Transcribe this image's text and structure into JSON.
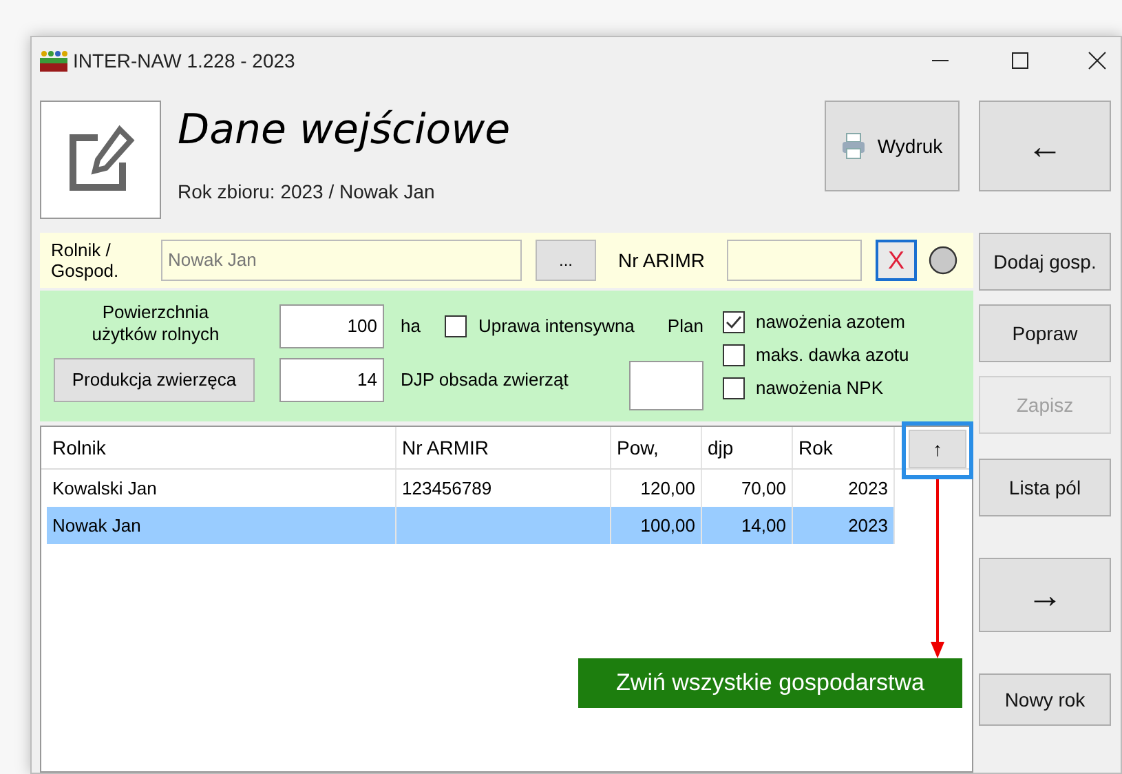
{
  "window": {
    "title": "INTER-NAW 1.228 - 2023"
  },
  "header": {
    "title": "Dane wejściowe",
    "subtitle": "Rok zbioru: 2023 / Nowak Jan",
    "print_button": "Wydruk"
  },
  "farmer_row": {
    "label": "Rolnik / Gospod.",
    "farmer_value": "Nowak Jan",
    "browse_button": "...",
    "arimr_label": "Nr ARIMR",
    "clear_button": "X"
  },
  "farm_panel": {
    "area_label": "Powierzchnia użytków rolnych",
    "area_value": "100",
    "area_unit": "ha",
    "livestock_button": "Produkcja zwierzęca",
    "livestock_value": "14",
    "livestock_label": "DJP obsada zwierząt",
    "plan_label": "Plan",
    "checkboxes": [
      {
        "label": "Uprawa intensywna",
        "checked": false
      },
      {
        "label": "nawożenia azotem",
        "checked": true
      },
      {
        "label": "maks. dawka azotu",
        "checked": false
      },
      {
        "label": "nawożenia NPK",
        "checked": false
      }
    ]
  },
  "table": {
    "columns": [
      "Rolnik",
      "Nr ARMIR",
      "Pow,",
      "djp",
      "Rok"
    ],
    "sort_button": "↑",
    "rows": [
      {
        "cells": [
          "Kowalski Jan",
          "123456789",
          "120,00",
          "70,00",
          "2023"
        ],
        "selected": false
      },
      {
        "cells": [
          "Nowak Jan",
          "",
          "100,00",
          "14,00",
          "2023"
        ],
        "selected": true
      }
    ]
  },
  "side_buttons": [
    {
      "kind": "back",
      "label": "←",
      "disabled": false
    },
    {
      "kind": "text",
      "label": "Dodaj gosp.",
      "disabled": false
    },
    {
      "kind": "text",
      "label": "Popraw",
      "disabled": false
    },
    {
      "kind": "text",
      "label": "Zapisz",
      "disabled": true
    },
    {
      "kind": "text",
      "label": "Lista pól",
      "disabled": false
    },
    {
      "kind": "arrow",
      "label": "→",
      "disabled": false
    },
    {
      "kind": "text",
      "label": "Nowy rok",
      "disabled": false
    }
  ],
  "annotation": {
    "text": "Zwiń wszystkie gospodarstwa"
  }
}
